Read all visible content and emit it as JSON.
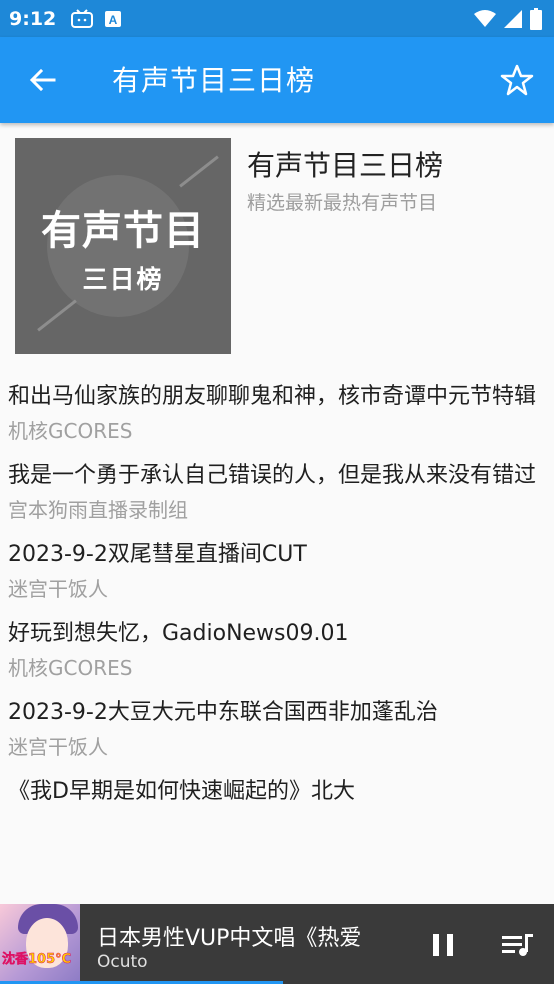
{
  "status_bar": {
    "time": "9:12",
    "icons": [
      "tv-icon",
      "a-badge-icon",
      "wifi-icon",
      "signal-icon",
      "battery-icon"
    ]
  },
  "app_bar": {
    "title": "有声节目三日榜",
    "back_icon": "arrow-left-icon",
    "star_icon": "star-outline-icon"
  },
  "header": {
    "cover_text_main": "有声节目",
    "cover_text_sub": "三日榜",
    "title": "有声节目三日榜",
    "subtitle": "精选最新最热有声节目"
  },
  "programs": [
    {
      "title": "和出马仙家族的朋友聊聊鬼和神，核市奇谭中元节特辑",
      "author": "机核GCORES"
    },
    {
      "title": "我是一个勇于承认自己错误的人，但是我从来没有错过",
      "author": "宫本狗雨直播录制组"
    },
    {
      "title": "2023-9-2双尾彗星直播间CUT",
      "author": "迷宫干饭人"
    },
    {
      "title": "好玩到想失忆，GadioNews09.01",
      "author": "机核GCORES"
    },
    {
      "title": "2023-9-2大豆大元中东联合国西非加蓬乱治",
      "author": "迷宫干饭人"
    },
    {
      "title": "《我D早期是如何快速崛起的》北大",
      "author": ""
    }
  ],
  "player": {
    "title": "日本男性VUP中文唱《热爱",
    "artist": "Ocuto",
    "art_badge": "沈香105°C",
    "progress": 0.51,
    "pause_icon": "pause-icon",
    "queue_icon": "playlist-icon"
  },
  "colors": {
    "status_bar": "#1e88d8",
    "app_bar": "#2196f3",
    "player_bg": "#3a3a3a",
    "accent": "#2196f3"
  }
}
